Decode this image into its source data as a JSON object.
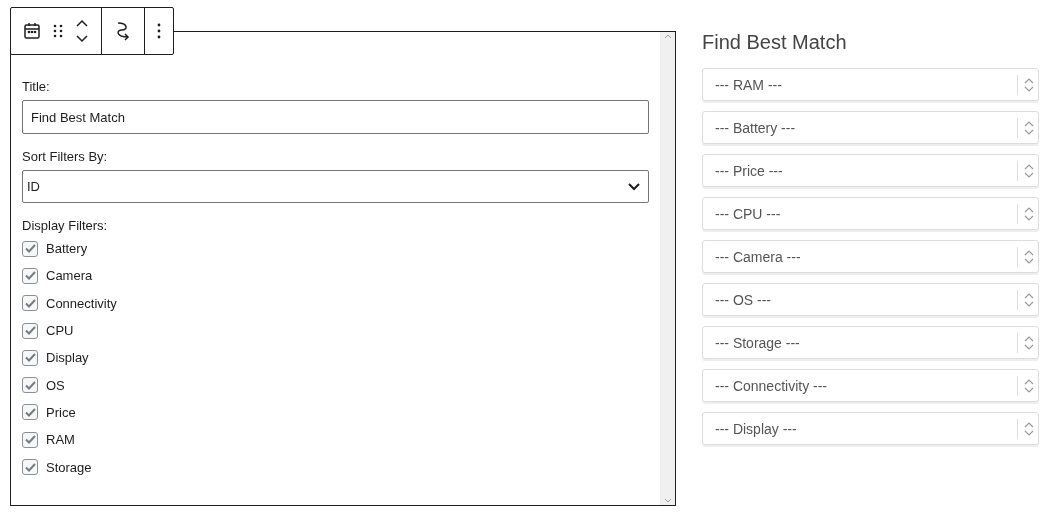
{
  "toolbar": {
    "buttons": [
      {
        "kind": "calendar"
      },
      {
        "kind": "drag"
      },
      {
        "kind": "move"
      },
      {
        "kind": "transform"
      },
      {
        "kind": "more"
      }
    ]
  },
  "panel": {
    "title_label": "Title:",
    "title_value": "Find Best Match",
    "sort_label": "Sort Filters By:",
    "sort_value": "ID",
    "display_label": "Display Filters:",
    "filters": [
      {
        "label": "Battery",
        "checked": true
      },
      {
        "label": "Camera",
        "checked": true
      },
      {
        "label": "Connectivity",
        "checked": true
      },
      {
        "label": "CPU",
        "checked": true
      },
      {
        "label": "Display",
        "checked": true
      },
      {
        "label": "OS",
        "checked": true
      },
      {
        "label": "Price",
        "checked": true
      },
      {
        "label": "RAM",
        "checked": true
      },
      {
        "label": "Storage",
        "checked": true
      }
    ]
  },
  "preview": {
    "title": "Find Best Match",
    "selects": [
      "--- RAM ---",
      "--- Battery ---",
      "--- Price ---",
      "--- CPU ---",
      "--- Camera ---",
      "--- OS ---",
      "--- Storage ---",
      "--- Connectivity ---",
      "--- Display ---"
    ]
  }
}
